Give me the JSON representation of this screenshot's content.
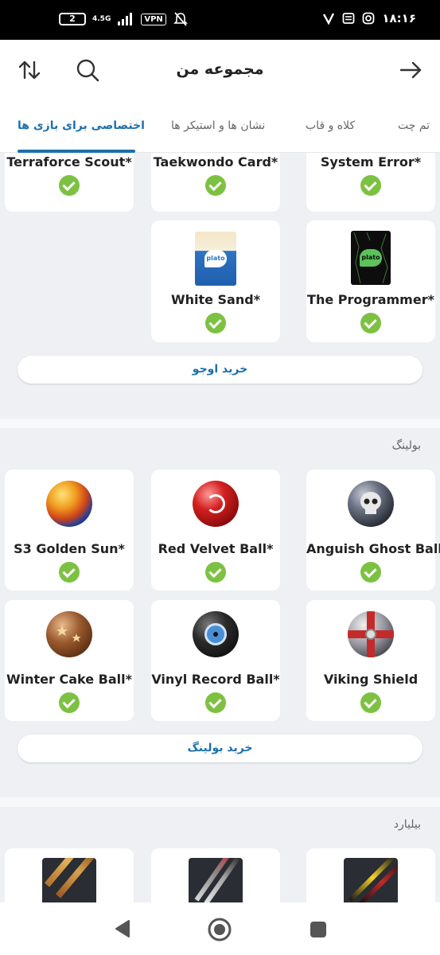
{
  "status": {
    "battery": "2",
    "network": "4.5G",
    "vpn": "VPN",
    "time": "۱۸:۱۶"
  },
  "header": {
    "title": "مجموعه من",
    "sort_icon": "sort-arrows-icon",
    "search_icon": "search-icon",
    "back_icon": "arrow-right-icon"
  },
  "tabs": [
    {
      "label": "اختصاصی برای بازی ها",
      "active": true
    },
    {
      "label": "نشان ها و استیکر ها",
      "active": false
    },
    {
      "label": "کلاه و قاب",
      "active": false
    },
    {
      "label": "تم چت",
      "active": false
    }
  ],
  "ojo": {
    "items": [
      {
        "name": "Terraforce Scout*",
        "owned": true
      },
      {
        "name": "Taekwondo Card*",
        "owned": true
      },
      {
        "name": "System Error*",
        "owned": true
      },
      {
        "name": "White Sand*",
        "owned": true,
        "logo": "plato"
      },
      {
        "name": "The Programmer*",
        "owned": true,
        "logo": "plato"
      }
    ],
    "buy_label": "خرید اوجو"
  },
  "bowling": {
    "title": "بولینگ",
    "items": [
      {
        "name": "S3 Golden Sun*",
        "owned": true
      },
      {
        "name": "Red Velvet Ball*",
        "owned": true
      },
      {
        "name": "Anguish Ghost Ball",
        "owned": true
      },
      {
        "name": "Winter Cake Ball*",
        "owned": true
      },
      {
        "name": "Vinyl Record Ball*",
        "owned": true
      },
      {
        "name": "Viking Shield",
        "owned": true
      }
    ],
    "buy_label": "خرید بولینگ"
  },
  "billiard": {
    "title": "بیلیارد"
  },
  "colors": {
    "accent": "#1b6fae",
    "check": "#7dc142"
  }
}
